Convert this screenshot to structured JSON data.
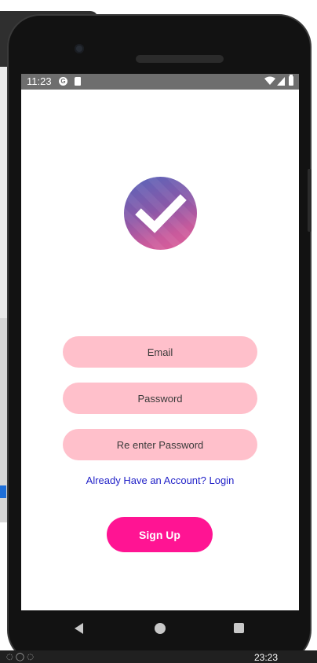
{
  "status_bar": {
    "time": "11:23",
    "left_icons": [
      "notification-g-icon",
      "sd-card-icon"
    ],
    "right_icons": [
      "wifi-icon",
      "signal-icon",
      "battery-icon"
    ],
    "background": "#6e6e6e"
  },
  "logo": {
    "icon": "checkmark-icon",
    "gradient": [
      "#5566bb",
      "#e0609a"
    ]
  },
  "form": {
    "email_placeholder": "Email",
    "password_placeholder": "Password",
    "reenter_password_placeholder": "Re enter Password",
    "field_color": "#ffc0cb"
  },
  "login_link": {
    "label": "Already Have an Account? Login",
    "color": "#2323c8"
  },
  "signup_button": {
    "label": "Sign Up",
    "color": "#ff1493"
  },
  "nav_bar": {
    "icons": [
      "back-icon",
      "home-icon",
      "recents-icon"
    ]
  },
  "host": {
    "clock": "23:23"
  }
}
